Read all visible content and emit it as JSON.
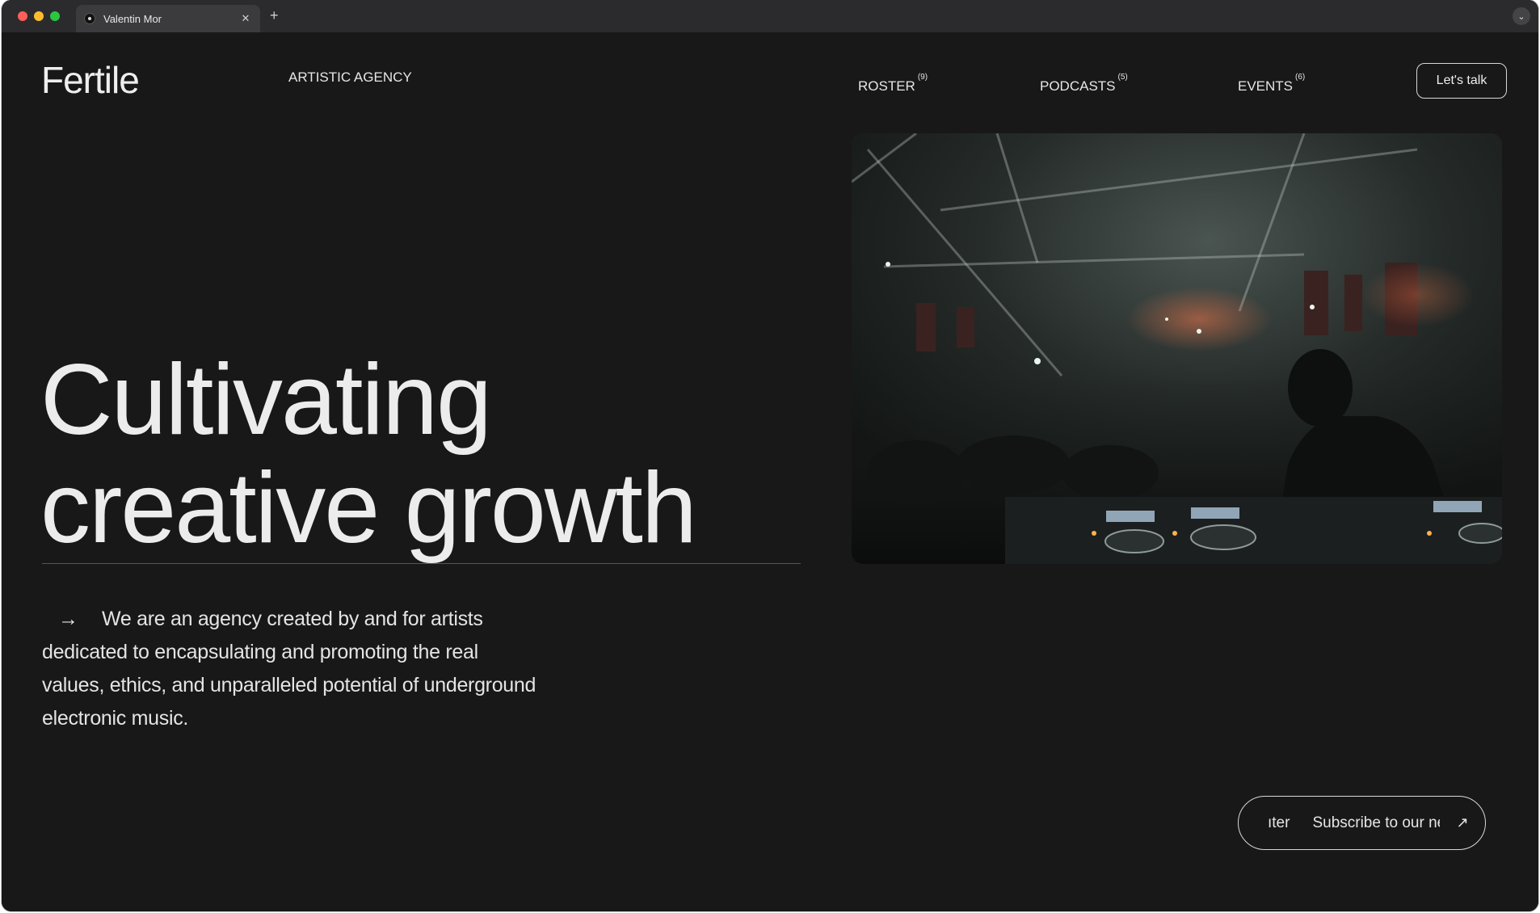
{
  "browser": {
    "tab_title": "Valentin Mor",
    "close_glyph": "✕",
    "new_tab_glyph": "+",
    "menu_glyph": "⌄"
  },
  "header": {
    "logo": "Fertile",
    "tagline": "ARTISTIC AGENCY",
    "nav": [
      {
        "label": "ROSTER",
        "count": "(9)"
      },
      {
        "label": "PODCASTS",
        "count": "(5)"
      },
      {
        "label": "EVENTS",
        "count": "(6)"
      }
    ],
    "cta": "Let's talk"
  },
  "hero": {
    "headline_line1": "Cultivating",
    "headline_line2": "creative growth",
    "arrow_glyph": "→",
    "intro": "We are an agency created by and for artists dedicated to encapsulating and promoting the real values, ethics, and unparalleled potential of underground electronic music.",
    "image_icon": "dj-club-photo"
  },
  "newsletter": {
    "marquee_fragment": "ıter",
    "marquee_text": "Subscribe to our ne",
    "arrow_glyph": "↗"
  },
  "colors": {
    "background": "#181818",
    "text": "#ececec",
    "chrome": "#2b2b2d"
  }
}
